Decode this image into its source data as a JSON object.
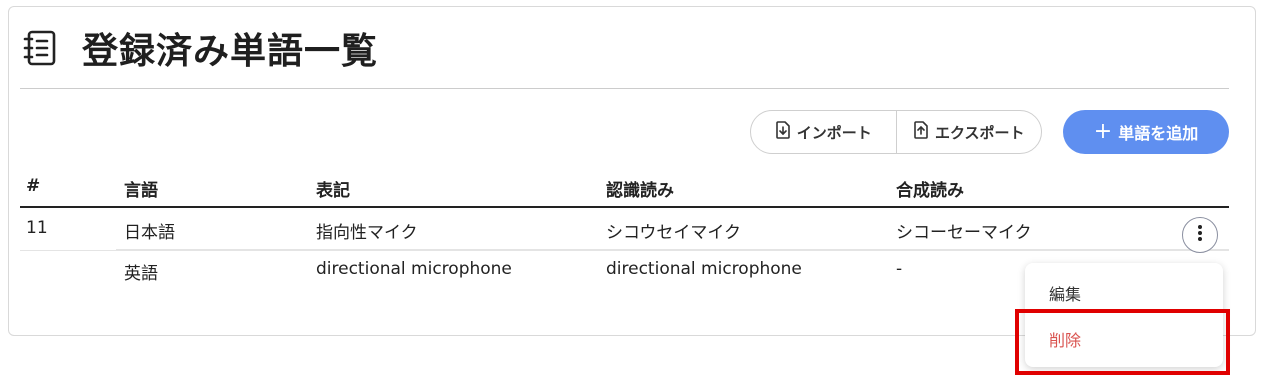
{
  "header": {
    "title": "登録済み単語一覧",
    "icon": "book-list-icon"
  },
  "toolbar": {
    "import_label": "インポート",
    "export_label": "エクスポート",
    "add_label": "単語を追加",
    "accent_color": "#5f8ff0"
  },
  "table": {
    "columns": [
      "#",
      "言語",
      "表記",
      "認識読み",
      "合成読み"
    ],
    "entries": [
      {
        "number": "11",
        "rows": [
          {
            "language": "日本語",
            "surface": "指向性マイク",
            "recognition": "シコウセイマイク",
            "synthesis": "シコーセーマイク"
          },
          {
            "language": "英語",
            "surface": "directional microphone",
            "recognition": "directional microphone",
            "synthesis": "-"
          }
        ]
      }
    ]
  },
  "menu": {
    "edit_label": "編集",
    "delete_label": "削除",
    "delete_color": "#d9534f"
  }
}
